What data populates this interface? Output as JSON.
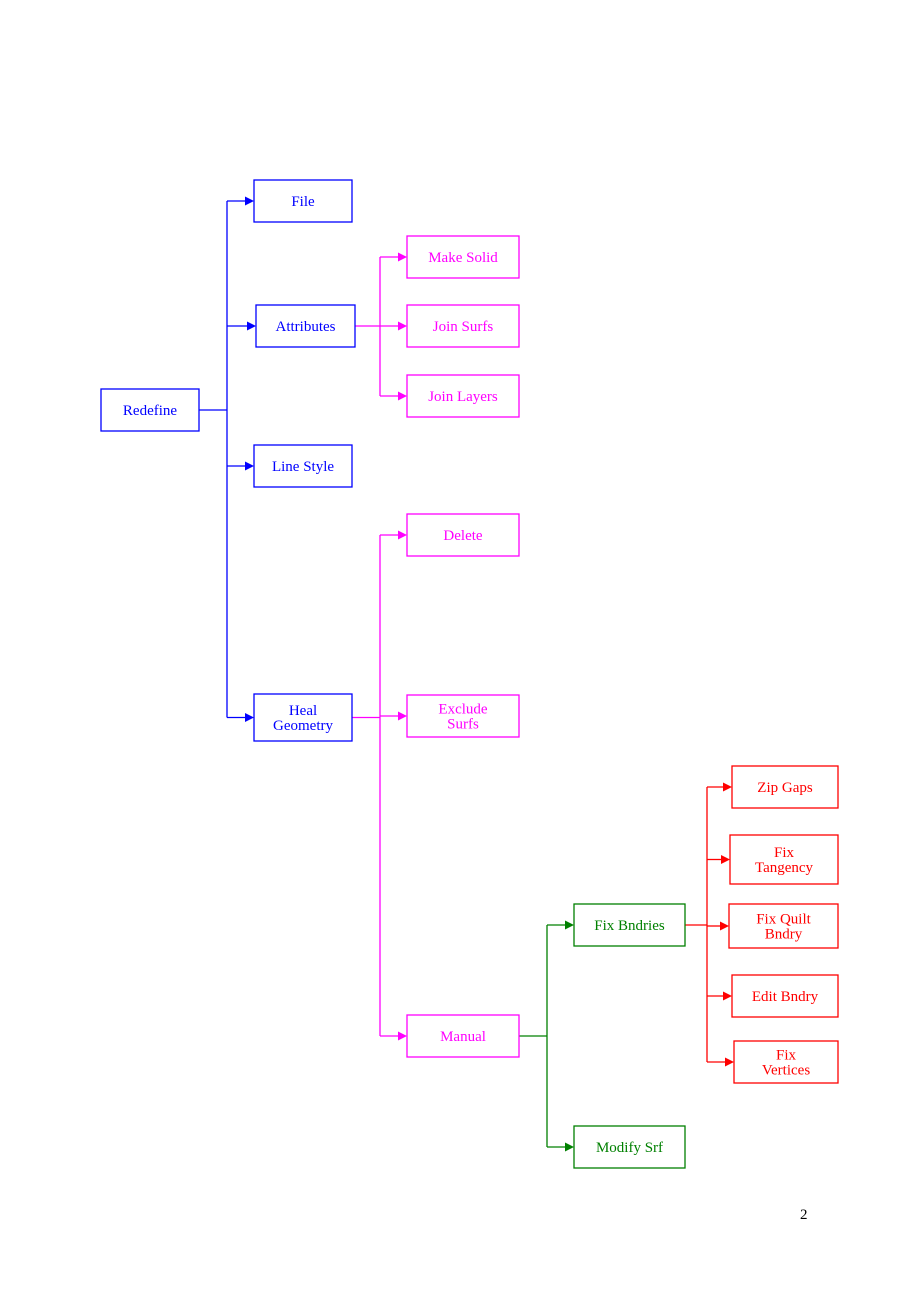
{
  "colors": {
    "blue": "#0000ff",
    "magenta": "#ff00ff",
    "green": "#008000",
    "red": "#ff0000"
  },
  "page_number": "2",
  "nodes": {
    "redefine": {
      "lines": [
        "Redefine"
      ],
      "color": "blue"
    },
    "file": {
      "lines": [
        "File"
      ],
      "color": "blue"
    },
    "attributes": {
      "lines": [
        "Attributes"
      ],
      "color": "blue"
    },
    "line_style": {
      "lines": [
        "Line Style"
      ],
      "color": "blue"
    },
    "heal_geometry": {
      "lines": [
        "Heal",
        "Geometry"
      ],
      "color": "blue"
    },
    "make_solid": {
      "lines": [
        "Make Solid"
      ],
      "color": "magenta"
    },
    "join_surfs": {
      "lines": [
        "Join Surfs"
      ],
      "color": "magenta"
    },
    "join_layers": {
      "lines": [
        "Join Layers"
      ],
      "color": "magenta"
    },
    "delete": {
      "lines": [
        "Delete"
      ],
      "color": "magenta"
    },
    "exclude_surfs": {
      "lines": [
        "Exclude",
        "Surfs"
      ],
      "color": "magenta"
    },
    "manual": {
      "lines": [
        "Manual"
      ],
      "color": "magenta"
    },
    "fix_bndries": {
      "lines": [
        "Fix Bndries"
      ],
      "color": "green"
    },
    "modify_srf": {
      "lines": [
        "Modify Srf"
      ],
      "color": "green"
    },
    "zip_gaps": {
      "lines": [
        "Zip Gaps"
      ],
      "color": "red"
    },
    "fix_tangency": {
      "lines": [
        "Fix",
        "Tangency"
      ],
      "color": "red"
    },
    "fix_quilt_bndry": {
      "lines": [
        "Fix Quilt",
        "Bndry"
      ],
      "color": "red"
    },
    "edit_bndry": {
      "lines": [
        "Edit Bndry"
      ],
      "color": "red"
    },
    "fix_vertices": {
      "lines": [
        "Fix",
        "Vertices"
      ],
      "color": "red"
    }
  },
  "edges": [
    {
      "from": "redefine",
      "to": [
        "file",
        "attributes",
        "line_style",
        "heal_geometry"
      ],
      "color": "blue"
    },
    {
      "from": "attributes",
      "to": [
        "make_solid",
        "join_surfs",
        "join_layers"
      ],
      "color": "magenta"
    },
    {
      "from": "heal_geometry",
      "to": [
        "delete",
        "exclude_surfs",
        "manual"
      ],
      "color": "magenta"
    },
    {
      "from": "manual",
      "to": [
        "fix_bndries",
        "modify_srf"
      ],
      "color": "green"
    },
    {
      "from": "fix_bndries",
      "to": [
        "zip_gaps",
        "fix_tangency",
        "fix_quilt_bndry",
        "edit_bndry",
        "fix_vertices"
      ],
      "color": "red"
    }
  ]
}
